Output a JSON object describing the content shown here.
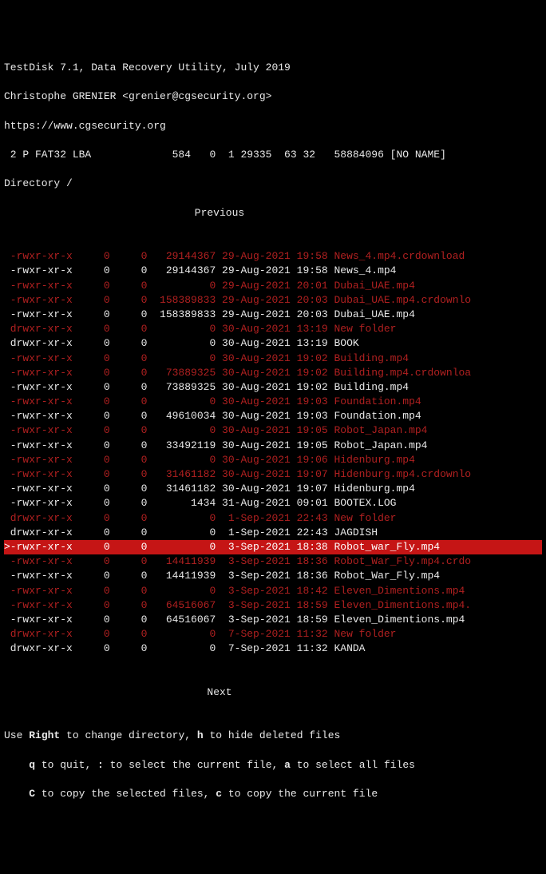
{
  "header": {
    "title": "TestDisk 7.1, Data Recovery Utility, July 2019",
    "author": "Christophe GRENIER <grenier@cgsecurity.org>",
    "url": "https://www.cgsecurity.org",
    "partition": " 2 P FAT32 LBA             584   0  1 29335  63 32   58884096 [NO NAME]",
    "dir": "Directory /"
  },
  "nav": {
    "prev": "Previous",
    "next": "Next"
  },
  "rows": [
    {
      "p": "-rwxr-xr-x",
      "u": "0",
      "g": "0",
      "s": "29144367",
      "d": "29-Aug-2021 19:58",
      "n": "News_4.mp4.crdownload",
      "del": true
    },
    {
      "p": "-rwxr-xr-x",
      "u": "0",
      "g": "0",
      "s": "29144367",
      "d": "29-Aug-2021 19:58",
      "n": "News_4.mp4",
      "del": false
    },
    {
      "p": "-rwxr-xr-x",
      "u": "0",
      "g": "0",
      "s": "0",
      "d": "29-Aug-2021 20:01",
      "n": "Dubai_UAE.mp4",
      "del": true
    },
    {
      "p": "-rwxr-xr-x",
      "u": "0",
      "g": "0",
      "s": "158389833",
      "d": "29-Aug-2021 20:03",
      "n": "Dubai_UAE.mp4.crdownlo",
      "del": true
    },
    {
      "p": "-rwxr-xr-x",
      "u": "0",
      "g": "0",
      "s": "158389833",
      "d": "29-Aug-2021 20:03",
      "n": "Dubai_UAE.mp4",
      "del": false
    },
    {
      "p": "drwxr-xr-x",
      "u": "0",
      "g": "0",
      "s": "0",
      "d": "30-Aug-2021 13:19",
      "n": "New folder",
      "del": true
    },
    {
      "p": "drwxr-xr-x",
      "u": "0",
      "g": "0",
      "s": "0",
      "d": "30-Aug-2021 13:19",
      "n": "BOOK",
      "del": false
    },
    {
      "p": "-rwxr-xr-x",
      "u": "0",
      "g": "0",
      "s": "0",
      "d": "30-Aug-2021 19:02",
      "n": "Building.mp4",
      "del": true
    },
    {
      "p": "-rwxr-xr-x",
      "u": "0",
      "g": "0",
      "s": "73889325",
      "d": "30-Aug-2021 19:02",
      "n": "Building.mp4.crdownloa",
      "del": true
    },
    {
      "p": "-rwxr-xr-x",
      "u": "0",
      "g": "0",
      "s": "73889325",
      "d": "30-Aug-2021 19:02",
      "n": "Building.mp4",
      "del": false
    },
    {
      "p": "-rwxr-xr-x",
      "u": "0",
      "g": "0",
      "s": "0",
      "d": "30-Aug-2021 19:03",
      "n": "Foundation.mp4",
      "del": true
    },
    {
      "p": "-rwxr-xr-x",
      "u": "0",
      "g": "0",
      "s": "49610034",
      "d": "30-Aug-2021 19:03",
      "n": "Foundation.mp4",
      "del": false
    },
    {
      "p": "-rwxr-xr-x",
      "u": "0",
      "g": "0",
      "s": "0",
      "d": "30-Aug-2021 19:05",
      "n": "Robot_Japan.mp4",
      "del": true
    },
    {
      "p": "-rwxr-xr-x",
      "u": "0",
      "g": "0",
      "s": "33492119",
      "d": "30-Aug-2021 19:05",
      "n": "Robot_Japan.mp4",
      "del": false
    },
    {
      "p": "-rwxr-xr-x",
      "u": "0",
      "g": "0",
      "s": "0",
      "d": "30-Aug-2021 19:06",
      "n": "Hidenburg.mp4",
      "del": true
    },
    {
      "p": "-rwxr-xr-x",
      "u": "0",
      "g": "0",
      "s": "31461182",
      "d": "30-Aug-2021 19:07",
      "n": "Hidenburg.mp4.crdownlo",
      "del": true
    },
    {
      "p": "-rwxr-xr-x",
      "u": "0",
      "g": "0",
      "s": "31461182",
      "d": "30-Aug-2021 19:07",
      "n": "Hidenburg.mp4",
      "del": false
    },
    {
      "p": "-rwxr-xr-x",
      "u": "0",
      "g": "0",
      "s": "1434",
      "d": "31-Aug-2021 09:01",
      "n": "BOOTEX.LOG",
      "del": false
    },
    {
      "p": "drwxr-xr-x",
      "u": "0",
      "g": "0",
      "s": "0",
      "d": " 1-Sep-2021 22:43",
      "n": "New folder",
      "del": true
    },
    {
      "p": "drwxr-xr-x",
      "u": "0",
      "g": "0",
      "s": "0",
      "d": " 1-Sep-2021 22:43",
      "n": "JAGDISH",
      "del": false
    },
    {
      "p": "-rwxr-xr-x",
      "u": "0",
      "g": "0",
      "s": "0",
      "d": " 3-Sep-2021 18:38",
      "n": "Robot_war_Fly.mp4",
      "del": true,
      "sel": true
    },
    {
      "p": "-rwxr-xr-x",
      "u": "0",
      "g": "0",
      "s": "14411939",
      "d": " 3-Sep-2021 18:36",
      "n": "Robot_War_Fly.mp4.crdo",
      "del": true
    },
    {
      "p": "-rwxr-xr-x",
      "u": "0",
      "g": "0",
      "s": "14411939",
      "d": " 3-Sep-2021 18:36",
      "n": "Robot_War_Fly.mp4",
      "del": false
    },
    {
      "p": "-rwxr-xr-x",
      "u": "0",
      "g": "0",
      "s": "0",
      "d": " 3-Sep-2021 18:42",
      "n": "Eleven_Dimentions.mp4",
      "del": true
    },
    {
      "p": "-rwxr-xr-x",
      "u": "0",
      "g": "0",
      "s": "64516067",
      "d": " 3-Sep-2021 18:59",
      "n": "Eleven_Dimentions.mp4.",
      "del": true
    },
    {
      "p": "-rwxr-xr-x",
      "u": "0",
      "g": "0",
      "s": "64516067",
      "d": " 3-Sep-2021 18:59",
      "n": "Eleven_Dimentions.mp4",
      "del": false
    },
    {
      "p": "drwxr-xr-x",
      "u": "0",
      "g": "0",
      "s": "0",
      "d": " 7-Sep-2021 11:32",
      "n": "New folder",
      "del": true
    },
    {
      "p": "drwxr-xr-x",
      "u": "0",
      "g": "0",
      "s": "0",
      "d": " 7-Sep-2021 11:32",
      "n": "KANDA",
      "del": false
    }
  ],
  "help": {
    "l1a": "Use ",
    "l1k1": "Right",
    "l1b": " to change directory, ",
    "l1k2": "h",
    "l1c": " to hide deleted files",
    "l2a": "    ",
    "l2k1": "q",
    "l2b": " to quit, ",
    "l2k2": ":",
    "l2c": " to select the current file, ",
    "l2k3": "a",
    "l2d": " to select all files",
    "l3a": "    ",
    "l3k1": "C",
    "l3b": " to copy the selected files, ",
    "l3k2": "c",
    "l3c": " to copy the current file"
  }
}
